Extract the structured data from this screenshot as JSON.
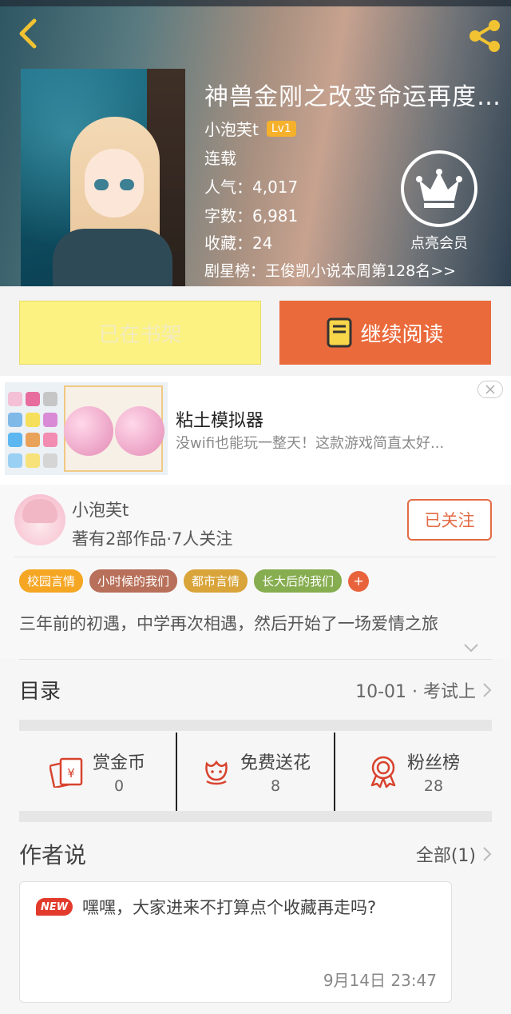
{
  "header": {
    "title": "神兽金刚之改变命运再度...",
    "author": "小泡芙t",
    "level": "Lv1",
    "status": "连载",
    "popularity": "人气：4,017",
    "word_count": "字数：6,981",
    "favorites": "收藏：24",
    "rank": "剧星榜：王俊凯小说本周第128名>>",
    "vip_label": "点亮会员"
  },
  "actions": {
    "shelf_label": "已在书架",
    "read_label": "继续阅读"
  },
  "ad": {
    "title": "粘土模拟器",
    "description": "没wifi也能玩一整天！这款游戏简直太好..."
  },
  "author_card": {
    "name": "小泡芙t",
    "stats": "著有2部作品·7人关注",
    "follow_label": "已关注",
    "tags": [
      {
        "label": "校园言情",
        "color": "#f5a623"
      },
      {
        "label": "小时候的我们",
        "color": "#b8705a"
      },
      {
        "label": "都市言情",
        "color": "#d9a43a"
      },
      {
        "label": "长大后的我们",
        "color": "#86ad4f"
      }
    ],
    "tag_plus": "+",
    "intro": "三年前的初遇，中学再次相遇，然后开始了一场爱情之旅"
  },
  "catalog": {
    "label": "目录",
    "latest": "10-01 · 考试上"
  },
  "stats": [
    {
      "label": "赏金币",
      "value": "0"
    },
    {
      "label": "免费送花",
      "value": "8"
    },
    {
      "label": "粉丝榜",
      "value": "28"
    }
  ],
  "author_says": {
    "label": "作者说",
    "all_label": "全部(1)",
    "badge": "NEW",
    "message": "嘿嘿，大家进来不打算点个收藏再走吗?",
    "time": "9月14日  23:47"
  },
  "colors": {
    "accent": "#ea6a3c",
    "shelf_button": "#fcf282",
    "level_badge": "#f5b12b"
  }
}
